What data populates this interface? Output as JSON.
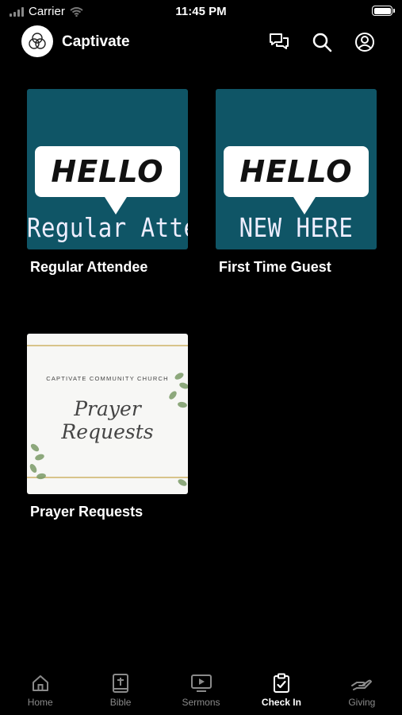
{
  "status_bar": {
    "carrier": "Carrier",
    "time": "11:45 PM"
  },
  "header": {
    "app_title": "Captivate",
    "icons": [
      "chat-icon",
      "search-icon",
      "profile-icon"
    ]
  },
  "cards": [
    {
      "label": "Regular Attendee",
      "image": {
        "heading": "HELLO",
        "subtext": "Regular Attendee",
        "bg": "#0f5566"
      }
    },
    {
      "label": "First Time Guest",
      "image": {
        "heading": "HELLO",
        "subtext": "NEW HERE",
        "bg": "#0f5566"
      }
    },
    {
      "label": "Prayer Requests",
      "image": {
        "church": "CAPTIVATE COMMUNITY CHURCH",
        "title": "Prayer Requests"
      }
    }
  ],
  "tab_bar": {
    "tabs": [
      {
        "label": "Home",
        "icon": "home-icon",
        "active": false
      },
      {
        "label": "Bible",
        "icon": "bible-icon",
        "active": false
      },
      {
        "label": "Sermons",
        "icon": "sermons-icon",
        "active": false
      },
      {
        "label": "Check In",
        "icon": "check-in-icon",
        "active": true
      },
      {
        "label": "Giving",
        "icon": "giving-icon",
        "active": false
      }
    ]
  },
  "colors": {
    "background": "#000000",
    "card_teal": "#0f5566",
    "tab_inactive": "#8a8a8a",
    "tab_active": "#ffffff"
  }
}
